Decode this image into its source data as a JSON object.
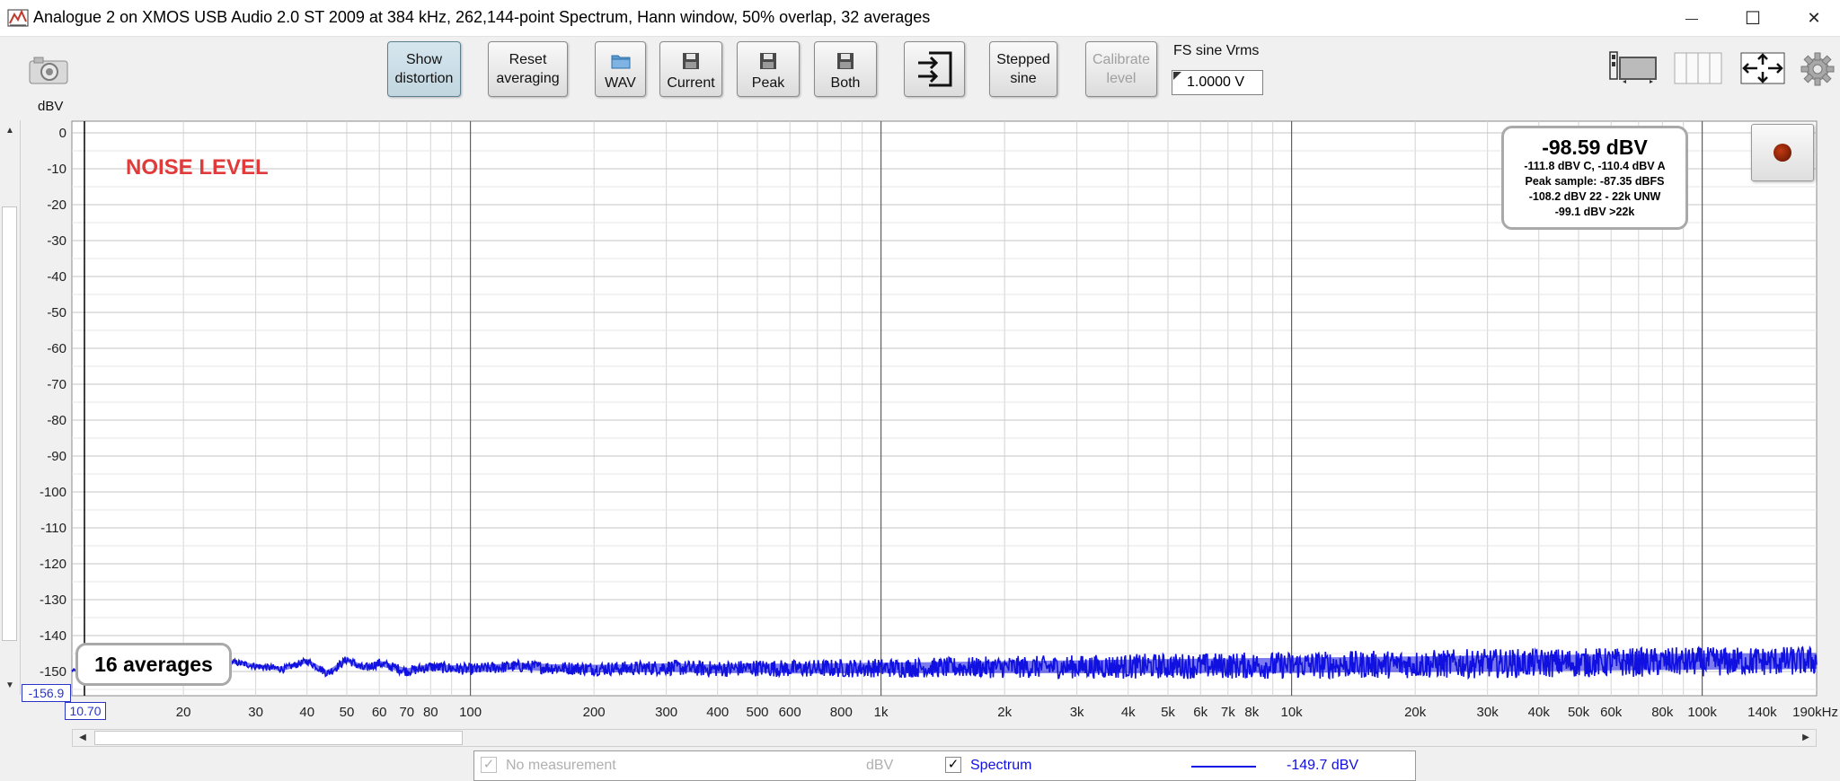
{
  "window": {
    "title": "Analogue 2 on XMOS USB Audio 2.0 ST 2009 at 384 kHz, 262,144-point Spectrum, Hann window, 50% overlap, 32 averages",
    "minimize_glyph": "—",
    "maximize_glyph": "☐",
    "close_glyph": "✕"
  },
  "toolbar": {
    "show_distortion": [
      "Show",
      "distortion"
    ],
    "reset_averaging": [
      "Reset",
      "averaging"
    ],
    "wav_label": "WAV",
    "current_label": "Current",
    "peak_label": "Peak",
    "both_label": "Both",
    "stepped_sine": [
      "Stepped",
      "sine"
    ],
    "calibrate_level": [
      "Calibrate",
      "level"
    ],
    "fs_sine_label": "FS sine Vrms",
    "fs_sine_value": "1.0000 V",
    "icons": [
      "camera-icon",
      "folder-icon",
      "save-icon",
      "import-icon",
      "layout-icon",
      "columns-icon",
      "move-icon",
      "gear-icon"
    ]
  },
  "plot": {
    "y_unit": "dBV",
    "noise_label": "NOISE LEVEL",
    "averages_badge": "16 averages",
    "y_min_value": "-156.9",
    "x_min_value": "10.70",
    "readout": {
      "main": "-98.59 dBV",
      "lines": [
        "-111.8 dBV C, -110.4 dBV A",
        "Peak sample: -87.35 dBFS",
        "-108.2 dBV 22 - 22k UNW",
        "-99.1 dBV >22k"
      ]
    }
  },
  "chart_data": {
    "type": "line",
    "x_scale": "log",
    "xlim": [
      10.7,
      190000
    ],
    "ylim": [
      -156.9,
      0
    ],
    "ylabel": "dBV",
    "x_tick_labels": [
      {
        "value": 20,
        "label": "20"
      },
      {
        "value": 30,
        "label": "30"
      },
      {
        "value": 40,
        "label": "40"
      },
      {
        "value": 50,
        "label": "50"
      },
      {
        "value": 60,
        "label": "60"
      },
      {
        "value": 70,
        "label": "70"
      },
      {
        "value": 80,
        "label": "80"
      },
      {
        "value": 100,
        "label": "100"
      },
      {
        "value": 200,
        "label": "200"
      },
      {
        "value": 300,
        "label": "300"
      },
      {
        "value": 400,
        "label": "400"
      },
      {
        "value": 500,
        "label": "500"
      },
      {
        "value": 600,
        "label": "600"
      },
      {
        "value": 800,
        "label": "800"
      },
      {
        "value": 1000,
        "label": "1k"
      },
      {
        "value": 2000,
        "label": "2k"
      },
      {
        "value": 3000,
        "label": "3k"
      },
      {
        "value": 4000,
        "label": "4k"
      },
      {
        "value": 5000,
        "label": "5k"
      },
      {
        "value": 6000,
        "label": "6k"
      },
      {
        "value": 7000,
        "label": "7k"
      },
      {
        "value": 8000,
        "label": "8k"
      },
      {
        "value": 10000,
        "label": "10k"
      },
      {
        "value": 20000,
        "label": "20k"
      },
      {
        "value": 30000,
        "label": "30k"
      },
      {
        "value": 40000,
        "label": "40k"
      },
      {
        "value": 50000,
        "label": "50k"
      },
      {
        "value": 60000,
        "label": "60k"
      },
      {
        "value": 80000,
        "label": "80k"
      },
      {
        "value": 100000,
        "label": "100k"
      },
      {
        "value": 140000,
        "label": "140k",
        "faded": true
      },
      {
        "value": 190000,
        "label": "190kHz"
      }
    ],
    "y_tick_labels": [
      "0",
      "-10",
      "-20",
      "-30",
      "-40",
      "-50",
      "-60",
      "-70",
      "-80",
      "-90",
      "-100",
      "-110",
      "-120",
      "-130",
      "-140",
      "-150"
    ],
    "y_tick_values": [
      0,
      -10,
      -20,
      -30,
      -40,
      -50,
      -60,
      -70,
      -80,
      -90,
      -100,
      -110,
      -120,
      -130,
      -140,
      -150
    ],
    "series": [
      {
        "color": "#1010e0",
        "x": [
          10.7,
          15,
          20,
          25,
          30,
          35,
          40,
          45,
          50,
          55,
          60,
          70,
          80,
          90,
          100,
          130,
          160,
          200,
          250,
          300,
          400,
          500,
          600,
          800,
          1000,
          1500,
          2000,
          3000,
          4000,
          5000,
          7000,
          10000,
          15000,
          20000,
          30000,
          40000,
          60000,
          80000,
          100000,
          140000,
          190000
        ],
        "y": [
          -150,
          -149.5,
          -150,
          -147.2,
          -148.8,
          -149.6,
          -147.4,
          -150.8,
          -147,
          -149.5,
          -148,
          -150.2,
          -149,
          -149.4,
          -149.7,
          -148.8,
          -149.3,
          -149.5,
          -149.4,
          -149.2,
          -149.6,
          -149.3,
          -149.5,
          -149.4,
          -149.3,
          -149.2,
          -149.1,
          -149.0,
          -148.9,
          -148.8,
          -148.7,
          -148.6,
          -148.4,
          -148.3,
          -148.1,
          -148.0,
          -147.8,
          -147.7,
          -147.6,
          -147.5,
          -147.4
        ],
        "noise_spread_db": [
          0.4,
          0.5,
          0.6,
          0.8,
          1.0,
          1.0,
          1.0,
          1.2,
          1.2,
          1.3,
          1.3,
          1.4,
          1.5,
          1.6,
          1.6,
          1.7,
          1.8,
          1.9,
          2.0,
          2.1,
          2.2,
          2.3,
          2.4,
          2.5,
          2.6,
          2.8,
          3.0,
          3.2,
          3.4,
          3.5,
          3.6,
          3.8,
          3.8,
          3.9,
          4.0,
          4.0,
          4.0,
          4.0,
          4.0,
          4.0,
          4.0
        ]
      }
    ]
  },
  "legend": {
    "no_measurement": "No measurement",
    "no_measurement_unit": "dBV",
    "spectrum_label": "Spectrum",
    "spectrum_value": "-149.7 dBV",
    "check_glyph": "✓",
    "spectrum_color": "#1010e0"
  }
}
